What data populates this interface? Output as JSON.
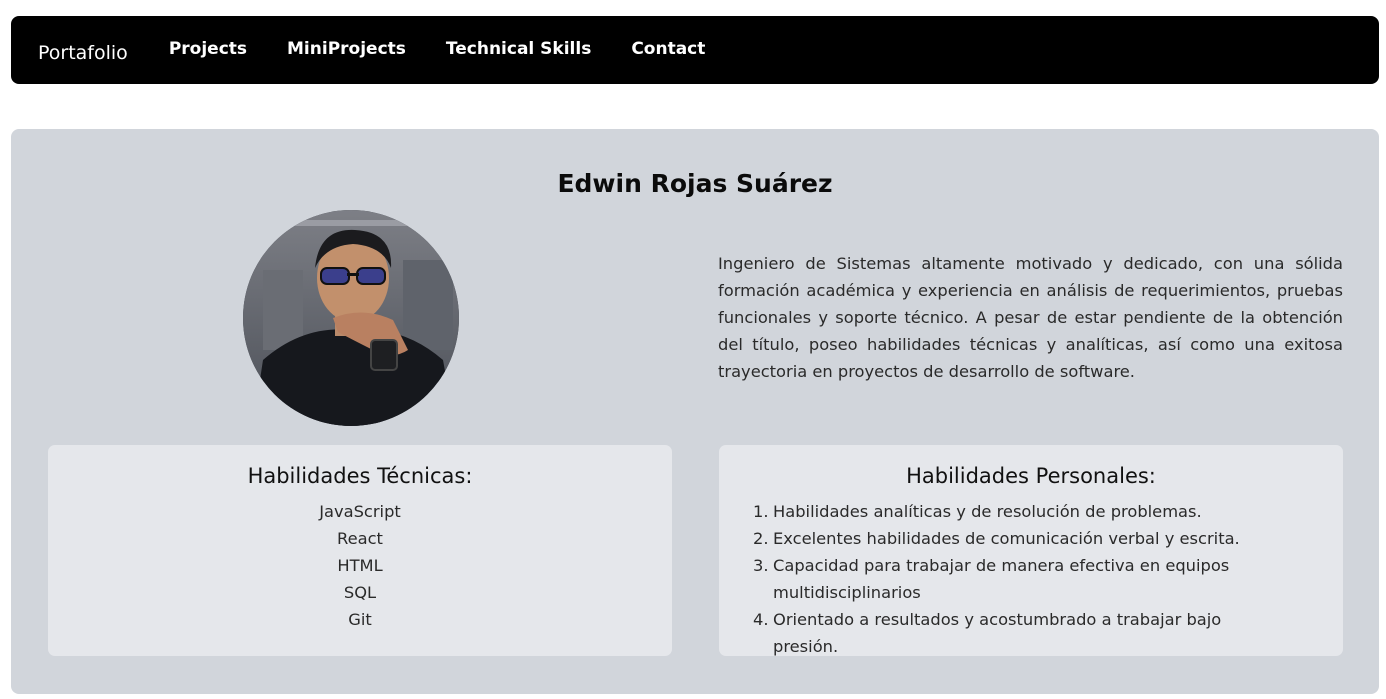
{
  "nav": {
    "brand": "Portafolio",
    "links": [
      "Projects",
      "MiniProjects",
      "Technical Skills",
      "Contact"
    ]
  },
  "profile": {
    "name": "Edwin Rojas Suárez",
    "bio": "Ingeniero de Sistemas altamente motivado y dedicado, con una sólida formación académica y experiencia en análisis de requerimientos, pruebas funcionales y soporte técnico. A pesar de estar pendiente de la obtención del título, poseo habilidades técnicas y analíticas, así como una exitosa trayectoria en proyectos de desarrollo de software."
  },
  "technical_skills": {
    "title": "Habilidades Técnicas:",
    "items": [
      "JavaScript",
      "React",
      "HTML",
      "SQL",
      "Git"
    ]
  },
  "personal_skills": {
    "title": "Habilidades Personales:",
    "items": [
      "Habilidades analíticas y de resolución de problemas.",
      "Excelentes habilidades de comunicación verbal y escrita.",
      "Capacidad para trabajar de manera efectiva en equipos multidisciplinarios",
      "Orientado a resultados y acostumbrado a trabajar bajo presión."
    ]
  },
  "colors": {
    "navbar": "#000000",
    "hero_bg": "#d1d5db",
    "card_bg": "#e5e7eb"
  }
}
